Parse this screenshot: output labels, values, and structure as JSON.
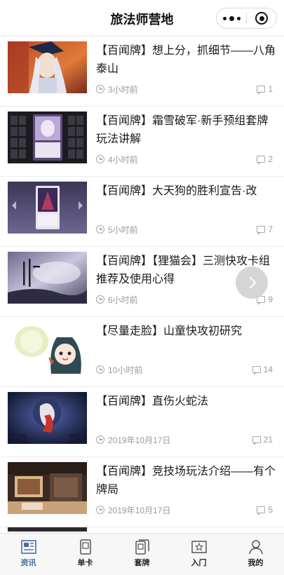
{
  "header": {
    "title": "旅法师营地"
  },
  "articles": [
    {
      "title": "【百闻牌】想上分，抓细节——八角泰山",
      "time": "3小时前",
      "comments": "1",
      "thumb": "character-portrait"
    },
    {
      "title": "【百闻牌】霜雪破军·新手预组套牌玩法讲解",
      "time": "4小时前",
      "comments": "2",
      "thumb": "deck-screenshot"
    },
    {
      "title": "【百闻牌】大天狗的胜利宣告·改",
      "time": "5小时前",
      "comments": "7",
      "thumb": "card-art"
    },
    {
      "title": "【百闻牌】【狸猫会】三测快攻卡组推荐及使用心得",
      "time": "6小时前",
      "comments": "9",
      "thumb": "title-banner"
    },
    {
      "title": "【尽量走脸】山童快攻初研究",
      "time": "10小时前",
      "comments": "14",
      "thumb": "chibi-characters"
    },
    {
      "title": "【百闻牌】直伤火蛇法",
      "time": "2019年10月17日",
      "comments": "21",
      "thumb": "battle-board"
    },
    {
      "title": "【百闻牌】竞技场玩法介绍——有个牌局",
      "time": "2019年10月17日",
      "comments": "5",
      "thumb": "arena-scene"
    }
  ],
  "tabs": [
    {
      "label": "资讯",
      "icon": "news-icon",
      "active": true
    },
    {
      "label": "单卡",
      "icon": "card-icon",
      "active": false
    },
    {
      "label": "套牌",
      "icon": "deck-icon",
      "active": false
    },
    {
      "label": "入门",
      "icon": "guide-icon",
      "active": false
    },
    {
      "label": "我的",
      "icon": "profile-icon",
      "active": false
    }
  ],
  "colors": {
    "accent": "#4a6da7",
    "text": "#1a1a1a",
    "meta": "#9a9a9a"
  }
}
